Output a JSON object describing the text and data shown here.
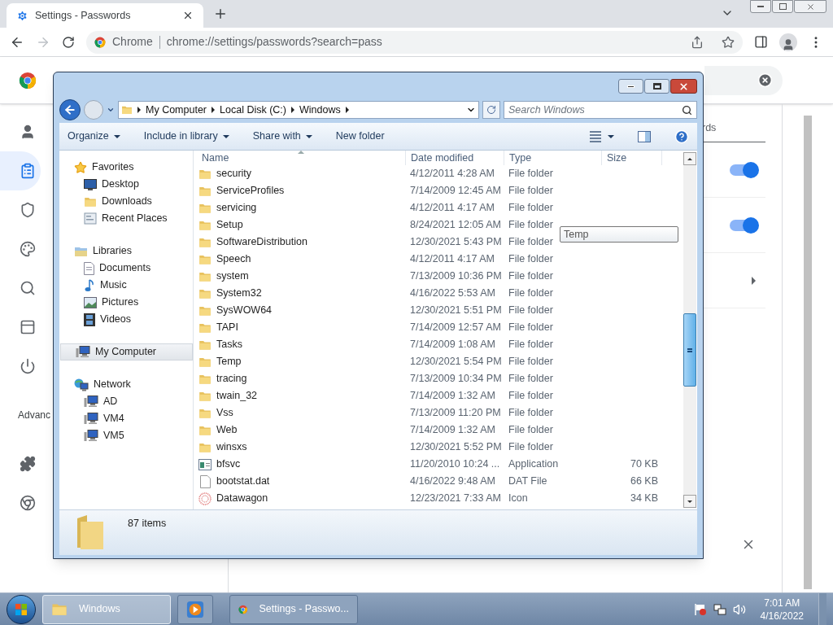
{
  "chrome": {
    "tab": {
      "title": "Settings - Passwords"
    },
    "address": {
      "site_label": "Chrome",
      "url": "chrome://settings/passwords?search=pass"
    },
    "nav": [
      {
        "selected": false
      },
      {
        "selected": true
      },
      {
        "selected": false
      },
      {
        "selected": false
      },
      {
        "selected": false
      },
      {
        "selected": false
      },
      {
        "selected": false
      },
      {
        "text": "Advanc",
        "selected": false
      },
      {
        "selected": false
      },
      {
        "selected": false
      }
    ],
    "heading_fragment": "rds",
    "rows": [
      {
        "kind": "toggle",
        "on": true
      },
      {
        "kind": "toggle",
        "on": true
      },
      {
        "kind": "arrow"
      }
    ]
  },
  "explorer": {
    "breadcrumb": [
      "My Computer",
      "Local Disk (C:)",
      "Windows"
    ],
    "search": {
      "placeholder": "Search Windows"
    },
    "toolbar": [
      {
        "label": "Organize",
        "dropdown": true
      },
      {
        "label": "Include in library",
        "dropdown": true
      },
      {
        "label": "Share with",
        "dropdown": true
      },
      {
        "label": "New folder",
        "dropdown": false
      }
    ],
    "nav_groups": [
      {
        "label": "Favorites",
        "selected": false,
        "children": [
          {
            "label": "Desktop",
            "selected": false
          },
          {
            "label": "Downloads",
            "selected": false
          },
          {
            "label": "Recent Places",
            "selected": false
          }
        ]
      },
      {
        "label": "Libraries",
        "selected": false,
        "children": [
          {
            "label": "Documents",
            "selected": false
          },
          {
            "label": "Music",
            "selected": false
          },
          {
            "label": "Pictures",
            "selected": false
          },
          {
            "label": "Videos",
            "selected": false
          }
        ]
      },
      {
        "label": "My Computer",
        "selected": true
      },
      {
        "label": "Network",
        "selected": false,
        "children": [
          {
            "label": "AD",
            "selected": false
          },
          {
            "label": "VM4",
            "selected": false
          },
          {
            "label": "VM5",
            "selected": false
          }
        ]
      }
    ],
    "columns": [
      "Name",
      "Date modified",
      "Type",
      "Size"
    ],
    "rows": [
      {
        "kind": "folder",
        "name": "security",
        "date": "4/12/2011 4:28 AM",
        "type": "File folder"
      },
      {
        "kind": "folder",
        "name": "ServiceProfiles",
        "date": "7/14/2009 12:45 AM",
        "type": "File folder"
      },
      {
        "kind": "folder",
        "name": "servicing",
        "date": "4/12/2011 4:17 AM",
        "type": "File folder"
      },
      {
        "kind": "folder",
        "name": "Setup",
        "date": "8/24/2021 12:05 AM",
        "type": "File folder"
      },
      {
        "kind": "folder",
        "name": "SoftwareDistribution",
        "date": "12/30/2021 5:43 PM",
        "type": "File folder"
      },
      {
        "kind": "folder",
        "name": "Speech",
        "date": "4/12/2011 4:17 AM",
        "type": "File folder"
      },
      {
        "kind": "folder",
        "name": "system",
        "date": "7/13/2009 10:36 PM",
        "type": "File folder"
      },
      {
        "kind": "folder",
        "name": "System32",
        "date": "4/16/2022 5:53 AM",
        "type": "File folder"
      },
      {
        "kind": "folder",
        "name": "SysWOW64",
        "date": "12/30/2021 5:51 PM",
        "type": "File folder"
      },
      {
        "kind": "folder",
        "name": "TAPI",
        "date": "7/14/2009 12:57 AM",
        "type": "File folder"
      },
      {
        "kind": "folder",
        "name": "Tasks",
        "date": "7/14/2009 1:08 AM",
        "type": "File folder"
      },
      {
        "kind": "folder",
        "name": "Temp",
        "date": "12/30/2021 5:54 PM",
        "type": "File folder"
      },
      {
        "kind": "folder",
        "name": "tracing",
        "date": "7/13/2009 10:34 PM",
        "type": "File folder"
      },
      {
        "kind": "folder",
        "name": "twain_32",
        "date": "7/14/2009 1:32 AM",
        "type": "File folder"
      },
      {
        "kind": "folder",
        "name": "Vss",
        "date": "7/13/2009 11:20 PM",
        "type": "File folder"
      },
      {
        "kind": "folder",
        "name": "Web",
        "date": "7/14/2009 1:32 AM",
        "type": "File folder"
      },
      {
        "kind": "folder",
        "name": "winsxs",
        "date": "12/30/2021 5:52 PM",
        "type": "File folder"
      },
      {
        "kind": "app",
        "name": "bfsvc",
        "date": "11/20/2010 10:24 ...",
        "type": "Application",
        "size": "70 KB"
      },
      {
        "kind": "file",
        "name": "bootstat.dat",
        "date": "4/16/2022 9:48 AM",
        "type": "DAT File",
        "size": "66 KB"
      },
      {
        "kind": "icon",
        "name": "Datawagon",
        "date": "12/23/2021 7:33 AM",
        "type": "Icon",
        "size": "34 KB"
      }
    ],
    "tooltip": "Temp",
    "status": "87 items"
  },
  "taskbar": {
    "items": [
      {
        "kind": "explorer",
        "label": "Windows",
        "selected": true
      },
      {
        "kind": "media",
        "selected": false
      },
      {
        "kind": "chrome",
        "label": "Settings - Passwo...",
        "selected": false
      }
    ],
    "time": "7:01 AM",
    "date": "4/16/2022"
  }
}
